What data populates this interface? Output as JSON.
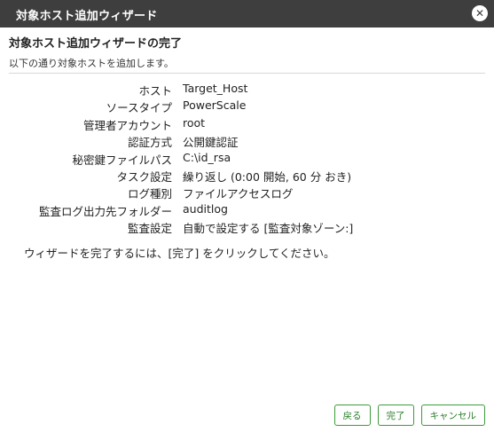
{
  "window": {
    "title": "対象ホスト追加ウィザード",
    "close_symbol": "✕"
  },
  "content": {
    "heading": "対象ホスト追加ウィザードの完了",
    "subheading": "以下の通り対象ホストを追加します。",
    "summary": [
      {
        "label": "ホスト",
        "value": "Target_Host"
      },
      {
        "label": "ソースタイプ",
        "value": "PowerScale"
      },
      {
        "label": "管理者アカウント",
        "value": "root"
      },
      {
        "label": "認証方式",
        "value": "公開鍵認証"
      },
      {
        "label": "秘密鍵ファイルパス",
        "value": "C:\\id_rsa"
      },
      {
        "label": "タスク設定",
        "value": "繰り返し (0:00 開始, 60 分 おき)"
      },
      {
        "label": "ログ種別",
        "value": "ファイルアクセスログ"
      },
      {
        "label": "監査ログ出力先フォルダー",
        "value": "auditlog"
      },
      {
        "label": "監査設定",
        "value": "自動で設定する [監査対象ゾーン:]"
      }
    ],
    "instruction": "ウィザードを完了するには、[完了] をクリックしてください。"
  },
  "footer": {
    "back_label": "戻る",
    "finish_label": "完了",
    "cancel_label": "キャンセル"
  },
  "icons": {
    "close": "close-icon"
  },
  "colors": {
    "titlebar": "#3e3e3e",
    "button_border": "#3c9a3c",
    "button_text": "#2a7f2a"
  }
}
